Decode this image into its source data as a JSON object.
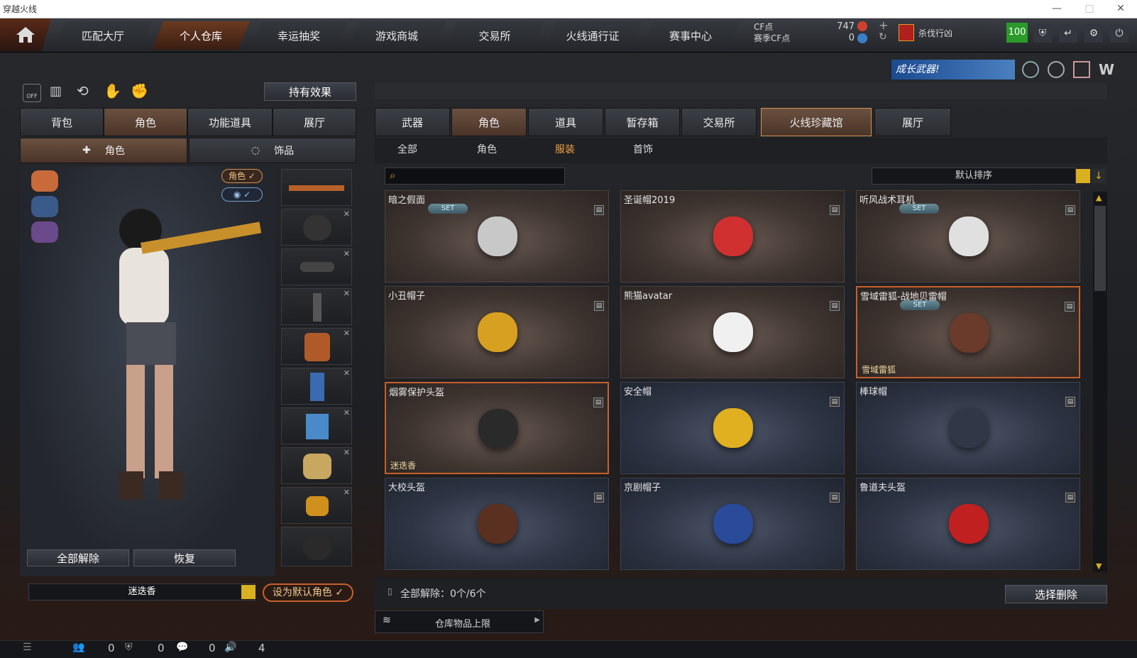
{
  "window": {
    "title": "穿越火线"
  },
  "nav": {
    "tabs": [
      "匹配大厅",
      "个人仓库",
      "幸运抽奖",
      "游戏商城",
      "交易所",
      "火线通行证",
      "赛事中心"
    ],
    "active": 1
  },
  "currency": {
    "cf_label": "CF点",
    "season_cf_label": "赛季CF点",
    "cf_value": "747",
    "season_value": "0"
  },
  "rank": {
    "label": "杀伐行凶"
  },
  "level_badge": "100",
  "promo": "成长武器!",
  "left": {
    "effect_button": "持有效果",
    "tabs": [
      "背包",
      "角色",
      "功能道具",
      "展厅"
    ],
    "subtabs": [
      "角色",
      "饰品"
    ],
    "badges": {
      "role": "角色"
    },
    "buttons": {
      "unequip_all": "全部解除",
      "restore": "恢复"
    },
    "character_name": "迷迭香",
    "set_default": "设为默认角色"
  },
  "right": {
    "tabs": [
      "武器",
      "角色",
      "道具",
      "暂存箱",
      "交易所",
      "火线珍藏馆",
      "展厅"
    ],
    "subtabs": [
      "全部",
      "角色",
      "服装",
      "首饰"
    ],
    "sort": "默认排序",
    "search_placeholder": "",
    "items": [
      {
        "name": "暗之假面",
        "set": "SET",
        "owner": "",
        "style": "brown",
        "selected": false
      },
      {
        "name": "圣诞帽2019",
        "set": "",
        "owner": "",
        "style": "brown",
        "selected": false
      },
      {
        "name": "听风战术耳机",
        "set": "SET",
        "owner": "",
        "style": "brown",
        "selected": false
      },
      {
        "name": "小丑帽子",
        "set": "",
        "owner": "",
        "style": "brown",
        "selected": false
      },
      {
        "name": "熊猫avatar",
        "set": "",
        "owner": "",
        "style": "brown",
        "selected": false
      },
      {
        "name": "雪域雷狐-战地贝雷帽",
        "set": "SET",
        "owner": "雪域雷狐",
        "style": "brown",
        "selected": true
      },
      {
        "name": "烟雾保护头盔",
        "set": "",
        "owner": "迷迭香",
        "style": "brown",
        "selected": true
      },
      {
        "name": "安全帽",
        "set": "",
        "owner": "",
        "style": "blue",
        "selected": false
      },
      {
        "name": "棒球帽",
        "set": "",
        "owner": "",
        "style": "blue",
        "selected": false
      },
      {
        "name": "大校头盔",
        "set": "",
        "owner": "",
        "style": "blue",
        "selected": false
      },
      {
        "name": "京剧帽子",
        "set": "",
        "owner": "",
        "style": "blue",
        "selected": false
      },
      {
        "name": "鲁道夫头盔",
        "set": "",
        "owner": "",
        "style": "blue",
        "selected": false
      }
    ],
    "unequip_status": "全部解除：0个/6个",
    "delete_button": "选择删除",
    "storage_limit": "仓库物品上限"
  },
  "statusbar": {
    "c1": "0",
    "c2": "0",
    "c3": "0",
    "c4": "4"
  }
}
